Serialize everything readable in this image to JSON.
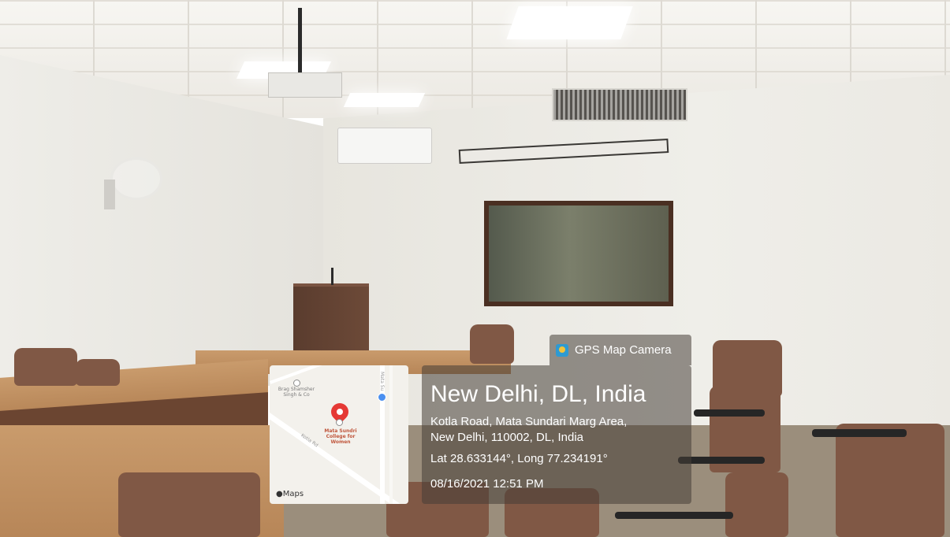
{
  "overlay": {
    "app_name": "GPS Map Camera",
    "app_icon": "gps-map-camera-icon",
    "city": "New Delhi, DL, India",
    "address_line1": "Kotla Road, Mata Sundari Marg Area,",
    "address_line2": "New Delhi, 110002, DL, India",
    "coordinates": "Lat 28.633144°, Long 77.234191°",
    "datetime": "08/16/2021 12:51 PM"
  },
  "map": {
    "poi_left_line1": "Brag Shamsher",
    "poi_left_line2": "Singh & Co",
    "college_line1": "Mata Sundri",
    "college_line2": "College for",
    "college_line3": "Women",
    "road_label": "Kotla Rd",
    "road_label_right": "Mata Su",
    "brand": "Maps",
    "pin_color": "#e53935"
  },
  "colors": {
    "overlay_bg": "rgba(70,62,55,0.55)",
    "map_bg": "#f3f1ec"
  }
}
